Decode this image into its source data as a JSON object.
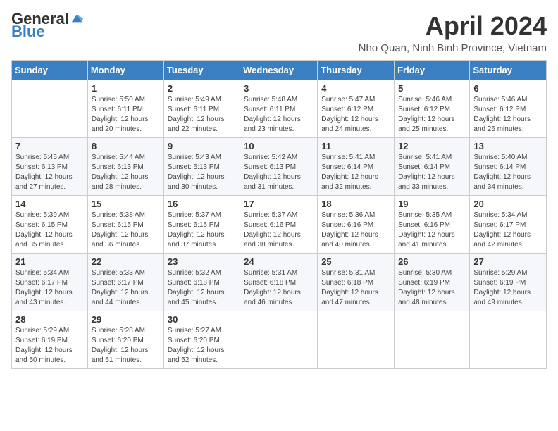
{
  "header": {
    "logo_general": "General",
    "logo_blue": "Blue",
    "month_title": "April 2024",
    "location": "Nho Quan, Ninh Binh Province, Vietnam"
  },
  "days_of_week": [
    "Sunday",
    "Monday",
    "Tuesday",
    "Wednesday",
    "Thursday",
    "Friday",
    "Saturday"
  ],
  "weeks": [
    [
      {
        "day": "",
        "info": ""
      },
      {
        "day": "1",
        "info": "Sunrise: 5:50 AM\nSunset: 6:11 PM\nDaylight: 12 hours\nand 20 minutes."
      },
      {
        "day": "2",
        "info": "Sunrise: 5:49 AM\nSunset: 6:11 PM\nDaylight: 12 hours\nand 22 minutes."
      },
      {
        "day": "3",
        "info": "Sunrise: 5:48 AM\nSunset: 6:11 PM\nDaylight: 12 hours\nand 23 minutes."
      },
      {
        "day": "4",
        "info": "Sunrise: 5:47 AM\nSunset: 6:12 PM\nDaylight: 12 hours\nand 24 minutes."
      },
      {
        "day": "5",
        "info": "Sunrise: 5:46 AM\nSunset: 6:12 PM\nDaylight: 12 hours\nand 25 minutes."
      },
      {
        "day": "6",
        "info": "Sunrise: 5:46 AM\nSunset: 6:12 PM\nDaylight: 12 hours\nand 26 minutes."
      }
    ],
    [
      {
        "day": "7",
        "info": "Sunrise: 5:45 AM\nSunset: 6:13 PM\nDaylight: 12 hours\nand 27 minutes."
      },
      {
        "day": "8",
        "info": "Sunrise: 5:44 AM\nSunset: 6:13 PM\nDaylight: 12 hours\nand 28 minutes."
      },
      {
        "day": "9",
        "info": "Sunrise: 5:43 AM\nSunset: 6:13 PM\nDaylight: 12 hours\nand 30 minutes."
      },
      {
        "day": "10",
        "info": "Sunrise: 5:42 AM\nSunset: 6:13 PM\nDaylight: 12 hours\nand 31 minutes."
      },
      {
        "day": "11",
        "info": "Sunrise: 5:41 AM\nSunset: 6:14 PM\nDaylight: 12 hours\nand 32 minutes."
      },
      {
        "day": "12",
        "info": "Sunrise: 5:41 AM\nSunset: 6:14 PM\nDaylight: 12 hours\nand 33 minutes."
      },
      {
        "day": "13",
        "info": "Sunrise: 5:40 AM\nSunset: 6:14 PM\nDaylight: 12 hours\nand 34 minutes."
      }
    ],
    [
      {
        "day": "14",
        "info": "Sunrise: 5:39 AM\nSunset: 6:15 PM\nDaylight: 12 hours\nand 35 minutes."
      },
      {
        "day": "15",
        "info": "Sunrise: 5:38 AM\nSunset: 6:15 PM\nDaylight: 12 hours\nand 36 minutes."
      },
      {
        "day": "16",
        "info": "Sunrise: 5:37 AM\nSunset: 6:15 PM\nDaylight: 12 hours\nand 37 minutes."
      },
      {
        "day": "17",
        "info": "Sunrise: 5:37 AM\nSunset: 6:16 PM\nDaylight: 12 hours\nand 38 minutes."
      },
      {
        "day": "18",
        "info": "Sunrise: 5:36 AM\nSunset: 6:16 PM\nDaylight: 12 hours\nand 40 minutes."
      },
      {
        "day": "19",
        "info": "Sunrise: 5:35 AM\nSunset: 6:16 PM\nDaylight: 12 hours\nand 41 minutes."
      },
      {
        "day": "20",
        "info": "Sunrise: 5:34 AM\nSunset: 6:17 PM\nDaylight: 12 hours\nand 42 minutes."
      }
    ],
    [
      {
        "day": "21",
        "info": "Sunrise: 5:34 AM\nSunset: 6:17 PM\nDaylight: 12 hours\nand 43 minutes."
      },
      {
        "day": "22",
        "info": "Sunrise: 5:33 AM\nSunset: 6:17 PM\nDaylight: 12 hours\nand 44 minutes."
      },
      {
        "day": "23",
        "info": "Sunrise: 5:32 AM\nSunset: 6:18 PM\nDaylight: 12 hours\nand 45 minutes."
      },
      {
        "day": "24",
        "info": "Sunrise: 5:31 AM\nSunset: 6:18 PM\nDaylight: 12 hours\nand 46 minutes."
      },
      {
        "day": "25",
        "info": "Sunrise: 5:31 AM\nSunset: 6:18 PM\nDaylight: 12 hours\nand 47 minutes."
      },
      {
        "day": "26",
        "info": "Sunrise: 5:30 AM\nSunset: 6:19 PM\nDaylight: 12 hours\nand 48 minutes."
      },
      {
        "day": "27",
        "info": "Sunrise: 5:29 AM\nSunset: 6:19 PM\nDaylight: 12 hours\nand 49 minutes."
      }
    ],
    [
      {
        "day": "28",
        "info": "Sunrise: 5:29 AM\nSunset: 6:19 PM\nDaylight: 12 hours\nand 50 minutes."
      },
      {
        "day": "29",
        "info": "Sunrise: 5:28 AM\nSunset: 6:20 PM\nDaylight: 12 hours\nand 51 minutes."
      },
      {
        "day": "30",
        "info": "Sunrise: 5:27 AM\nSunset: 6:20 PM\nDaylight: 12 hours\nand 52 minutes."
      },
      {
        "day": "",
        "info": ""
      },
      {
        "day": "",
        "info": ""
      },
      {
        "day": "",
        "info": ""
      },
      {
        "day": "",
        "info": ""
      }
    ]
  ]
}
